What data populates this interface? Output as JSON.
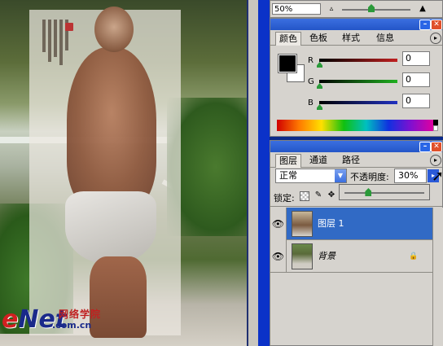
{
  "watermark": {
    "logo_e": "e",
    "logo_rest": "Net",
    "chinese": "网络学院",
    "url": ".com.cn"
  },
  "navigator": {
    "zoom_value": "50%",
    "zoom_min_icon": "▵",
    "zoom_max_icon": "▲"
  },
  "color_panel": {
    "tabs": [
      "颜色",
      "色板",
      "样式",
      "信息"
    ],
    "active_tab": "颜色",
    "channels": [
      {
        "label": "R",
        "value": "0",
        "color": "#c02020"
      },
      {
        "label": "G",
        "value": "0",
        "color": "#20b020"
      },
      {
        "label": "B",
        "value": "0",
        "color": "#2030c0"
      }
    ],
    "foreground_color": "#000000",
    "background_color": "#ffffff"
  },
  "layers_panel": {
    "tabs": [
      "图层",
      "通道",
      "路径"
    ],
    "active_tab": "图层",
    "blend_mode": "正常",
    "opacity_label": "不透明度:",
    "opacity_value": "30%",
    "opacity_fraction": 0.3,
    "lock_label": "锁定:",
    "lock_icons": [
      "lock-transparent-icon",
      "lock-brush-icon",
      "lock-move-icon"
    ],
    "layers": [
      {
        "name": "图层 1",
        "selected": true,
        "visible": true
      },
      {
        "name": "背景",
        "selected": false,
        "visible": true,
        "locked": true
      }
    ]
  },
  "colors": {
    "accent": "#316ac5",
    "titlebar": "#2456c8",
    "panel_bg": "#d6d3ce"
  }
}
